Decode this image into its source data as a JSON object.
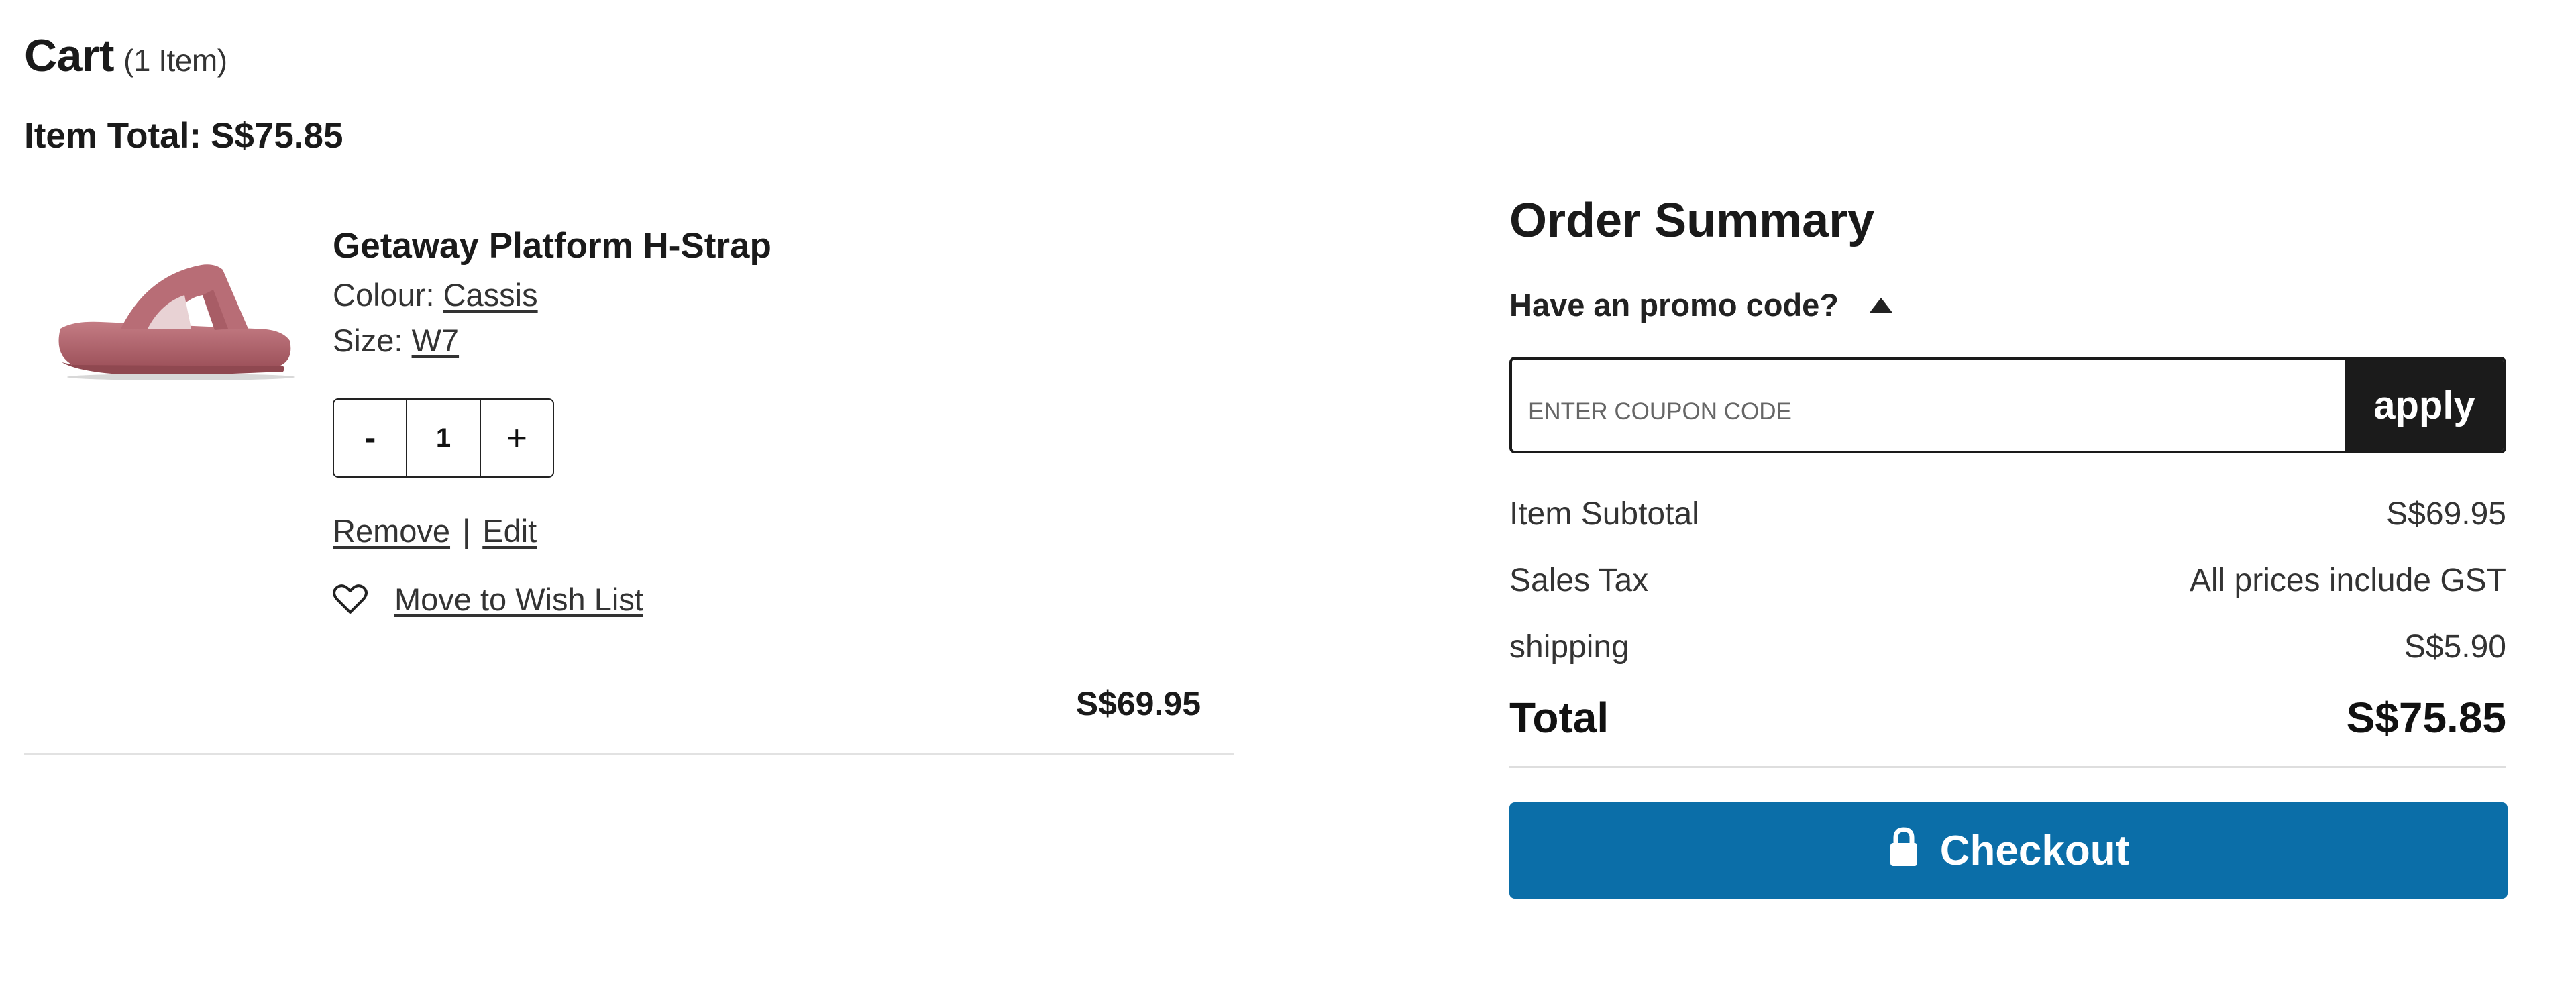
{
  "cart": {
    "title": "Cart",
    "count_label": "(1 Item)",
    "item_total_label": "Item Total:",
    "item_total_value": "S$75.85"
  },
  "item": {
    "name": "Getaway Platform H-Strap",
    "colour_label": "Colour:",
    "colour_value": "Cassis",
    "size_label": "Size:",
    "size_value": "W7",
    "quantity": "1",
    "minus_label": "-",
    "plus_label": "+",
    "remove_label": "Remove",
    "separator": "|",
    "edit_label": "Edit",
    "wishlist_label": "Move to Wish List",
    "price": "S$69.95",
    "image_icon": "sandal-product-image",
    "image_color": "#b96a73"
  },
  "summary": {
    "title": "Order Summary",
    "promo_toggle_label": "Have an promo code?",
    "coupon_placeholder": "ENTER COUPON CODE",
    "apply_label": "apply",
    "rows": {
      "subtotal_label": "Item Subtotal",
      "subtotal_value": "S$69.95",
      "tax_label": "Sales Tax",
      "tax_value": "All prices include GST",
      "shipping_label": "shipping",
      "shipping_value": "S$5.90",
      "total_label": "Total",
      "total_value": "S$75.85"
    },
    "checkout_label": "Checkout",
    "checkout_color": "#0b6ea8"
  }
}
